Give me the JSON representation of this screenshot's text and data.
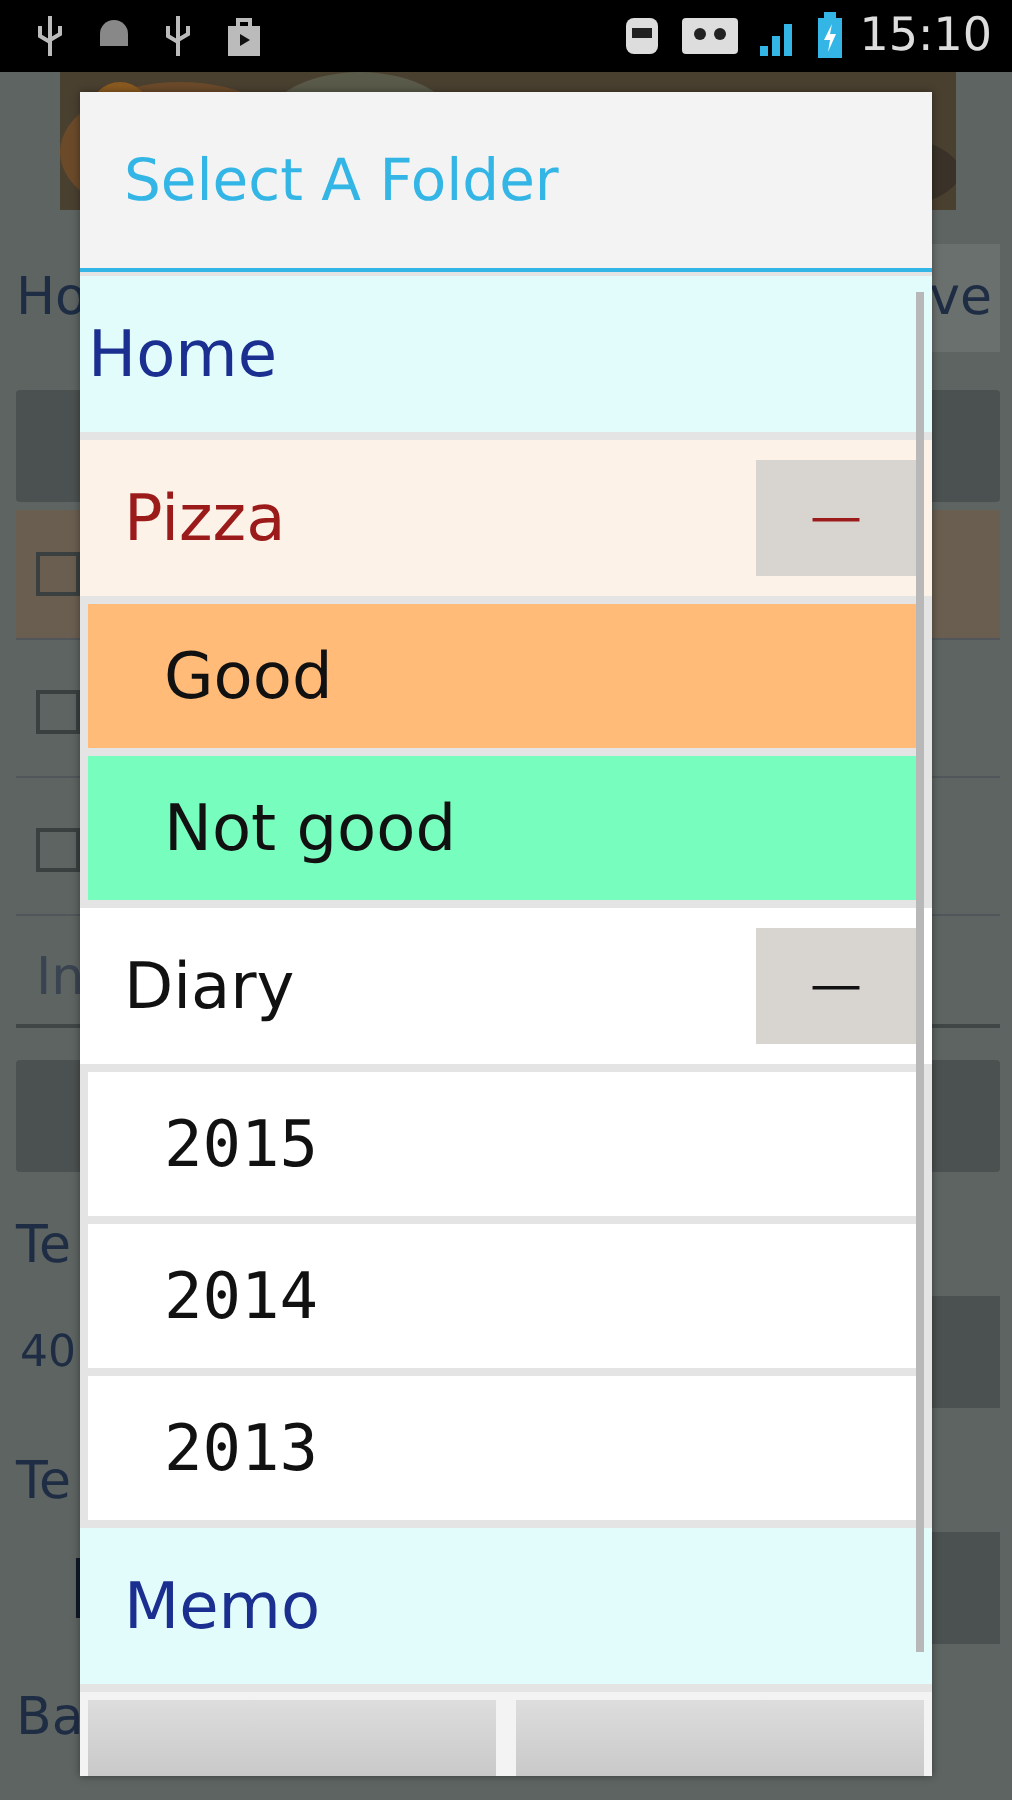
{
  "status_bar": {
    "time": "15:10"
  },
  "background": {
    "texts": [
      "Ho",
      "ve",
      "In",
      "Te",
      "40",
      "Te",
      "Ba"
    ],
    "checkboxes": [
      {
        "checked": false
      },
      {
        "checked": false
      },
      {
        "checked": false
      }
    ]
  },
  "dialog": {
    "title": "Select A Folder",
    "folders": [
      {
        "label": "Home",
        "color": "#e2fcfc",
        "kind": "fixed"
      },
      {
        "label": "Pizza",
        "color": "#fdf2e7",
        "kind": "category",
        "expanded": true,
        "toggle": "—",
        "children": [
          {
            "label": "Good",
            "color": "#ffbb77"
          },
          {
            "label": "Not good",
            "color": "#77fdbd"
          }
        ]
      },
      {
        "label": "Diary",
        "color": "#ffffff",
        "kind": "folder",
        "expanded": true,
        "toggle": "—",
        "children": [
          {
            "label": "2015",
            "color": "#ffffff"
          },
          {
            "label": "2014",
            "color": "#ffffff"
          },
          {
            "label": "2013",
            "color": "#ffffff"
          }
        ]
      },
      {
        "label": "Memo",
        "color": "#e2fcfc",
        "kind": "fixed"
      }
    ]
  }
}
